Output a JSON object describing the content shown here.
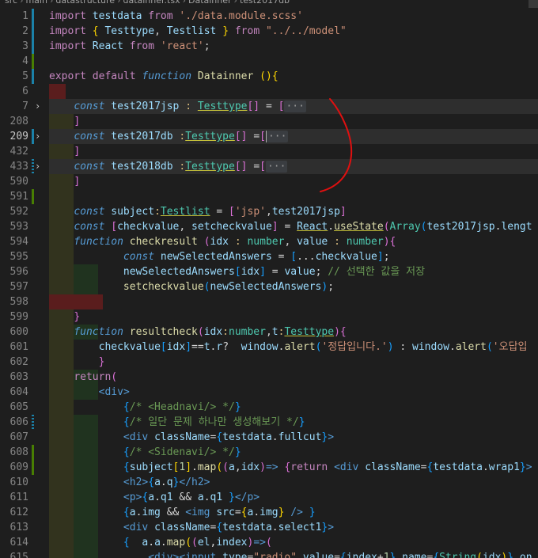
{
  "breadcrumb": [
    "src",
    "main",
    "datastructure",
    "datainner.tsx",
    "Datainner",
    "test2017db"
  ],
  "lines": [
    {
      "num": "1",
      "html": "<span class='k'>import</span> <span class='v'>testdata</span> <span class='k'>from</span> <span class='s'>'./data.module.scss'</span>"
    },
    {
      "num": "2",
      "html": "<span class='k'>import</span> <span class='br'>{</span> <span class='v'>Testtype</span>, <span class='v'>Testlist</span> <span class='br'>}</span> <span class='k'>from</span> <span class='s'>\"../../model\"</span>"
    },
    {
      "num": "3",
      "html": "<span class='k'>import</span> <span class='v'>React</span> <span class='k'>from</span> <span class='s'>'react'</span>;"
    },
    {
      "num": "4",
      "html": ""
    },
    {
      "num": "5",
      "html": "<span class='k'>export</span> <span class='k'>default</span> <span class='ki'>function</span> <span class='f'>Datainner</span> <span class='br'>()</span><span class='br'>{</span>"
    },
    {
      "num": "6",
      "html": ""
    },
    {
      "num": "7",
      "html": "    <span class='ki'>const</span> <span class='v'>test2017jsp</span> <span class='gold'>:</span> <span class='t ul'>Testtype</span><span class='br2'>[]</span> <span class='op'>=</span> <span class='br2'>[</span><span class='dots'>···</span>"
    },
    {
      "num": "208",
      "html": "    <span class='br2'>]</span>"
    },
    {
      "num": "209",
      "html": "    <span class='ki'>const</span> <span class='v'>test2017db</span> <span class='gold'>:</span><span class='t ul'>Testtype</span><span class='br2'>[]</span> <span class='op'>=</span><span class='br2'>[</span><span class='cursor'></span><span class='dots'>···</span>"
    },
    {
      "num": "432",
      "html": "    <span class='br2'>]</span>"
    },
    {
      "num": "433",
      "html": "    <span class='ki'>const</span> <span class='v'>test2018db</span> <span class='gold'>:</span><span class='t ul'>Testtype</span><span class='br2'>[]</span> <span class='op'>=</span><span class='br2'>[</span><span class='dots'>···</span>"
    },
    {
      "num": "590",
      "html": "    <span class='br2'>]</span>"
    },
    {
      "num": "591",
      "html": ""
    },
    {
      "num": "592",
      "html": "    <span class='ki'>const</span> <span class='v'>subject</span><span class='gold'>:</span><span class='t ul'>Testlist</span> <span class='op'>=</span> <span class='br2'>[</span><span class='s'>'jsp'</span>,<span class='v'>test2017jsp</span><span class='br2'>]</span>"
    },
    {
      "num": "593",
      "html": "    <span class='ki'>const</span> <span class='br2'>[</span><span class='v'>checkvalue</span>, <span class='v'>setcheckvalue</span><span class='br2'>]</span> <span class='op'>=</span> <span class='v ul'>React</span>.<span class='f ul'>useState</span><span class='br2'>(</span><span class='t'>Array</span><span class='br3'>(</span><span class='v'>test2017jsp</span>.<span class='v'>lengt</span>"
    },
    {
      "num": "594",
      "html": "    <span class='ki'>function</span> <span class='f'>checkresult</span> <span class='br2'>(</span><span class='v'>idx</span> <span class='gold'>:</span> <span class='t'>number</span>, <span class='v'>value</span> <span class='gold'>:</span> <span class='t'>number</span><span class='br2'>)</span><span class='br2'>{</span>"
    },
    {
      "num": "595",
      "html": "            <span class='ki'>const</span> <span class='v'>newSelectedAnswers</span> <span class='op'>=</span> <span class='br3'>[</span>...<span class='v'>checkvalue</span><span class='br3'>]</span>;"
    },
    {
      "num": "596",
      "html": "            <span class='v'>newSelectedAnswers</span><span class='br3'>[</span><span class='v'>idx</span><span class='br3'>]</span> <span class='op'>=</span> <span class='v'>value</span>; <span class='c'>// 선택한 값을 저장</span>"
    },
    {
      "num": "597",
      "html": "            <span class='f'>setcheckvalue</span><span class='br3'>(</span><span class='v'>newSelectedAnswers</span><span class='br3'>)</span>;"
    },
    {
      "num": "598",
      "html": ""
    },
    {
      "num": "599",
      "html": "    <span class='br2'>}</span>"
    },
    {
      "num": "600",
      "html": "    <span class='ki'>function</span> <span class='f'>resultcheck</span><span class='br2'>(</span><span class='v'>idx</span><span class='gold'>:</span><span class='t'>number</span>,<span class='v'>t</span><span class='gold'>:</span><span class='t ul'>Testtype</span><span class='br2'>)</span><span class='br2'>{</span>"
    },
    {
      "num": "601",
      "html": "        <span class='v'>checkvalue</span><span class='br3'>[</span><span class='v'>idx</span><span class='br3'>]</span><span class='op'>==</span><span class='v'>t</span>.<span class='v'>r</span><span class='op'>?</span>  <span class='v'>window</span>.<span class='f'>alert</span><span class='br3'>(</span><span class='s'>'정답입니다.'</span><span class='br3'>)</span> <span class='op'>:</span> <span class='v'>window</span>.<span class='f'>alert</span><span class='br3'>(</span><span class='s'>'오답입</span>"
    },
    {
      "num": "602",
      "html": "        <span class='br2'>}</span>"
    },
    {
      "num": "603",
      "html": "    <span class='k'>return</span><span class='br2'>(</span>"
    },
    {
      "num": "604",
      "html": "        <span class='tag'>&lt;</span><span class='tag'>div</span><span class='tag'>&gt;</span>"
    },
    {
      "num": "605",
      "html": "            <span class='br3'>{</span><span class='c'>/* &lt;Headnavi/&gt; */</span><span class='br3'>}</span>"
    },
    {
      "num": "606",
      "html": "            <span class='br3'>{</span><span class='c'>/* 일단 문제 하나만 생성해보기 */</span><span class='br3'>}</span>"
    },
    {
      "num": "607",
      "html": "            <span class='tag'>&lt;div</span> <span class='attr'>className</span><span class='op'>=</span><span class='br3'>{</span><span class='v'>testdata</span>.<span class='v'>fullcut</span><span class='br3'>}</span><span class='tag'>&gt;</span>"
    },
    {
      "num": "608",
      "html": "            <span class='br3'>{</span><span class='c'>/* &lt;Sidenavi/&gt; */</span><span class='br3'>}</span>"
    },
    {
      "num": "609",
      "html": "            <span class='br3'>{</span><span class='v'>subject</span><span class='br'>[</span><span class='n'>1</span><span class='br'>]</span>.<span class='f'>map</span><span class='br'>(</span><span class='br2'>(</span><span class='v'>a</span>,<span class='v'>idx</span><span class='br2'>)</span><span class='kb'>=&gt;</span> <span class='br2'>{</span><span class='k'>return</span> <span class='tag'>&lt;div</span> <span class='attr'>className</span><span class='op'>=</span><span class='br3'>{</span><span class='v'>testdata</span>.<span class='v'>wrap1</span><span class='br3'>}</span><span class='tag'>&gt;</span>"
    },
    {
      "num": "610",
      "html": "            <span class='tag'>&lt;h2&gt;</span><span class='br3'>{</span><span class='v'>a</span>.<span class='v'>q</span><span class='br3'>}</span><span class='tag'>&lt;/h2&gt;</span>"
    },
    {
      "num": "611",
      "html": "            <span class='tag'>&lt;p&gt;</span><span class='br3'>{</span><span class='v'>a</span>.<span class='v'>q1</span> <span class='op'>&amp;&amp;</span> <span class='v'>a</span>.<span class='v'>q1</span> <span class='br3'>}</span><span class='tag'>&lt;/p&gt;</span>"
    },
    {
      "num": "612",
      "html": "            <span class='br3'>{</span><span class='v'>a</span>.<span class='v'>img</span> <span class='op'>&amp;&amp;</span> <span class='tag'>&lt;img</span> <span class='attr'>src</span><span class='op'>=</span><span class='br'>{</span><span class='v'>a</span>.<span class='v'>img</span><span class='br'>}</span> <span class='tag'>/&gt;</span> <span class='br3'>}</span>"
    },
    {
      "num": "613",
      "html": "            <span class='tag'>&lt;div</span> <span class='attr'>className</span><span class='op'>=</span><span class='br3'>{</span><span class='v'>testdata</span>.<span class='v'>select1</span><span class='br3'>}</span><span class='tag'>&gt;</span>"
    },
    {
      "num": "614",
      "html": "            <span class='br3'>{</span>  <span class='v'>a</span>.<span class='v'>a</span>.<span class='f'>map</span><span class='br'>(</span><span class='br2'>(</span><span class='v'>el</span>,<span class='v'>index</span><span class='br2'>)</span><span class='kb'>=&gt;</span><span class='br2'>(</span>"
    },
    {
      "num": "615",
      "html": "                <span class='tag'>&lt;div&gt;&lt;input</span> <span class='attr'>type</span><span class='op'>=</span><span class='s'>\"radio\"</span> <span class='attr'>value</span><span class='op'>=</span><span class='br3'>{</span><span class='v'>index</span><span class='op'>+</span><span class='n'>1</span><span class='br3'>}</span> <span class='attr'>name</span><span class='op'>=</span><span class='br3'>{</span><span class='t'>String</span><span class='br'>(</span><span class='v'>idx</span><span class='br'>)</span><span class='br3'>}</span> <span class='attr'>on</span>"
    }
  ]
}
